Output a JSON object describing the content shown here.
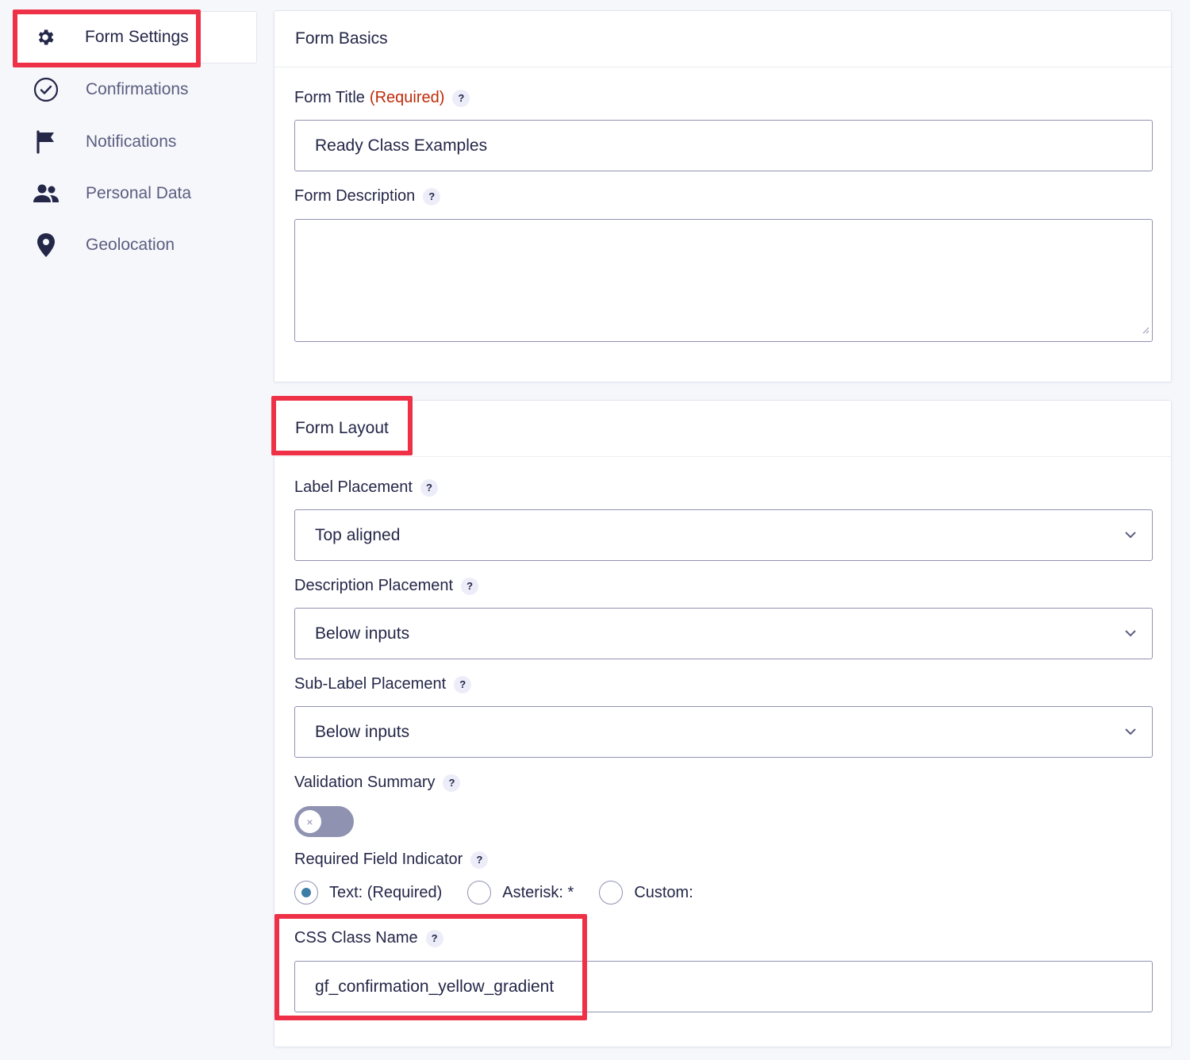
{
  "sidebar": {
    "items": [
      {
        "label": "Form Settings",
        "icon": "gear-icon",
        "active": true
      },
      {
        "label": "Confirmations",
        "icon": "check-circle-icon"
      },
      {
        "label": "Notifications",
        "icon": "flag-icon"
      },
      {
        "label": "Personal Data",
        "icon": "users-icon"
      },
      {
        "label": "Geolocation",
        "icon": "map-pin-icon"
      }
    ]
  },
  "form_basics": {
    "title": "Form Basics",
    "form_title_label": "Form Title",
    "required_text": "(Required)",
    "help": "?",
    "form_title_value": "Ready Class Examples",
    "form_description_label": "Form Description",
    "form_description_value": ""
  },
  "form_layout": {
    "title": "Form Layout",
    "label_placement_label": "Label Placement",
    "label_placement_value": "Top aligned",
    "description_placement_label": "Description Placement",
    "description_placement_value": "Below inputs",
    "sublabel_placement_label": "Sub-Label Placement",
    "sublabel_placement_value": "Below inputs",
    "validation_summary_label": "Validation Summary",
    "validation_summary_on": false,
    "toggle_off_glyph": "×",
    "required_indicator_label": "Required Field Indicator",
    "required_options": [
      "Text: (Required)",
      "Asterisk: *",
      "Custom:"
    ],
    "required_selected": 0,
    "css_class_label": "CSS Class Name",
    "css_class_value": "gf_confirmation_yellow_gradient"
  },
  "colors": {
    "highlight": "#ee3147",
    "required": "#c02b0a",
    "text": "#242748",
    "radio_selected": "#3e7da6"
  }
}
